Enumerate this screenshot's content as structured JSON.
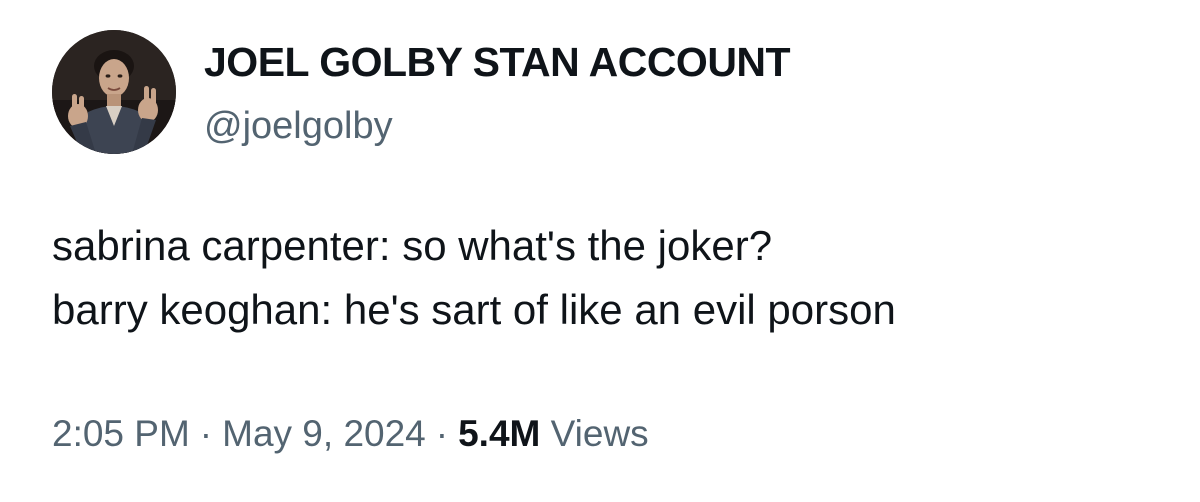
{
  "author": {
    "display_name": "JOEL GOLBY STAN ACCOUNT",
    "handle": "@joelgolby",
    "avatar_icon": "profile-photo"
  },
  "tweet": {
    "lines": [
      "sabrina carpenter: so what's the joker?",
      "barry keoghan: he's sart of like an evil porson"
    ]
  },
  "meta": {
    "time": "2:05 PM",
    "separator": "·",
    "date": "May 9, 2024",
    "views_count": "5.4M",
    "views_label": "Views"
  },
  "colors": {
    "text_primary": "#0f1419",
    "text_secondary": "#536471",
    "background": "#ffffff"
  }
}
